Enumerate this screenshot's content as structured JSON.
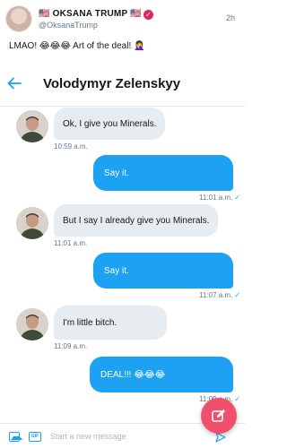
{
  "post": {
    "author_name": "🇺🇸 OKSANA TRUMP 🇺🇸",
    "verified_mark": "✓",
    "author_handle": "@OksanaTrump",
    "time": "2h",
    "text": "LMAO! 😂😂😂 Art of the deal! 🤦‍♀️"
  },
  "dm": {
    "title": "Volodymyr Zelenskyy",
    "messages": [
      {
        "dir": "in",
        "text": "Ok, I give you Minerals.",
        "time": "10:59 a.m."
      },
      {
        "dir": "out",
        "text": "Say it.",
        "time": "11:01 a.m."
      },
      {
        "dir": "in",
        "text": "But I say I already give you Minerals.",
        "time": "11:01 a.m."
      },
      {
        "dir": "out",
        "text": "Say it.",
        "time": "11:07 a.m."
      },
      {
        "dir": "in",
        "text": "I'm little bitch.",
        "time": "11:09 a.m."
      },
      {
        "dir": "out",
        "text": "DEAL!!! 😂😂😂",
        "time": "11:09 a.m."
      }
    ],
    "read_mark": "✓",
    "composer": {
      "placeholder": "Start a new message",
      "gif_label": "GIF"
    }
  },
  "colors": {
    "accent": "#1da1f2",
    "incoming_bubble": "#e6ecf0",
    "fab": "#f0506e",
    "verified": "#e0245e"
  },
  "icons": [
    "back-arrow-icon",
    "image-icon",
    "gif-icon",
    "send-icon",
    "compose-icon",
    "verified-icon",
    "check-icon"
  ]
}
